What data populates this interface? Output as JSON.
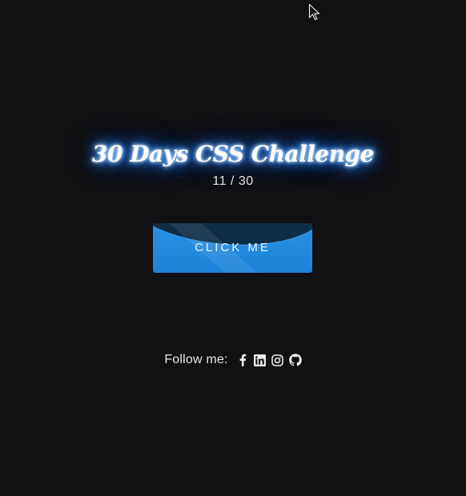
{
  "header": {
    "title": "30 Days CSS Challenge",
    "counter": "11 / 30"
  },
  "button": {
    "label": "CLICK ME",
    "color": "#2a92e6"
  },
  "footer": {
    "follow_label": "Follow me:",
    "icons": [
      "facebook-icon",
      "linkedin-icon",
      "instagram-icon",
      "github-icon"
    ]
  },
  "colors": {
    "background": "#111012",
    "glow": "#2d8bff"
  }
}
